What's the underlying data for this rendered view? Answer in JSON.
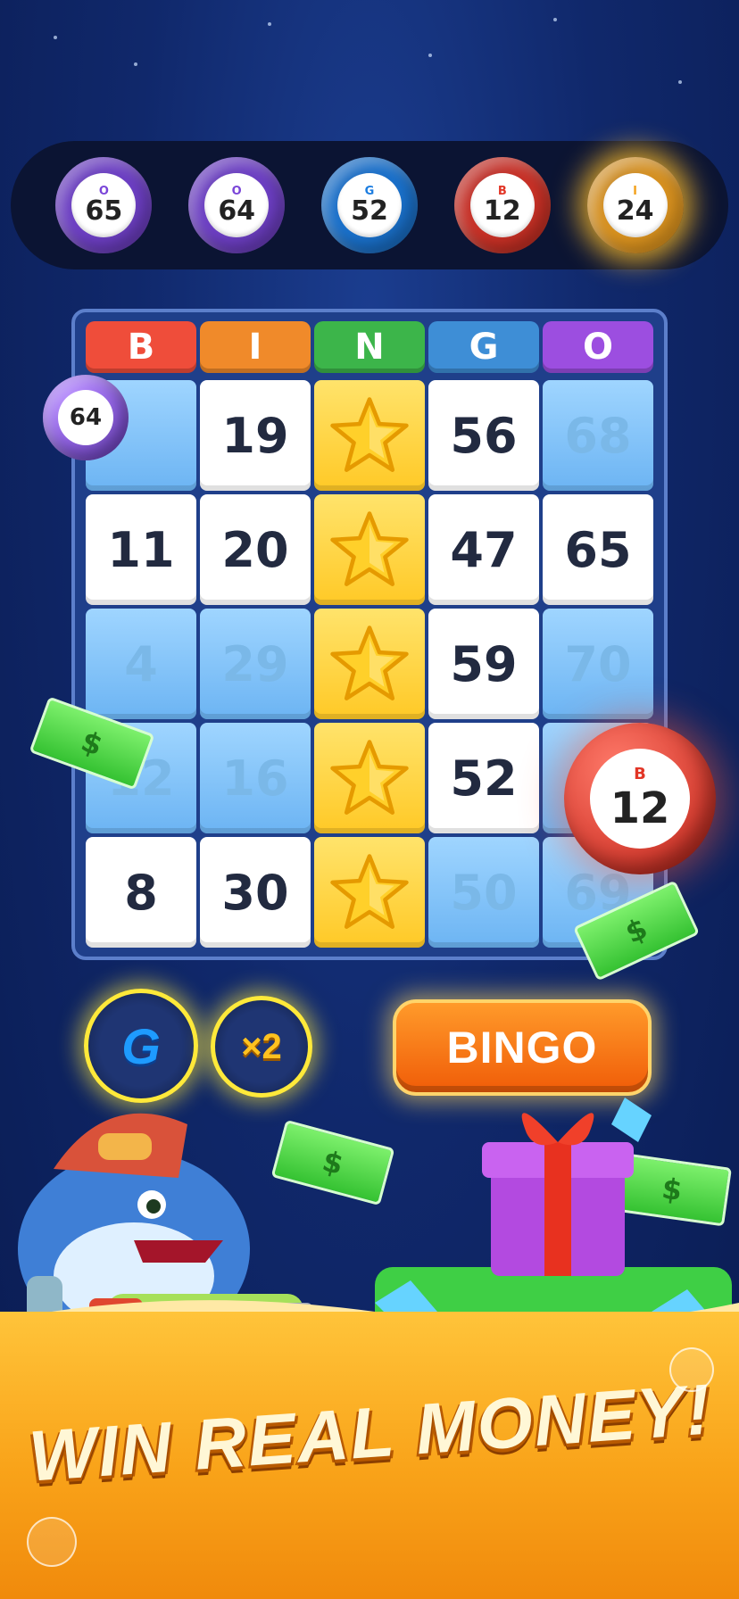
{
  "called_balls": [
    {
      "letter": "O",
      "number": "65",
      "color": "#7a45d8"
    },
    {
      "letter": "O",
      "number": "64",
      "color": "#7a45d8"
    },
    {
      "letter": "G",
      "number": "52",
      "color": "#1c7de0"
    },
    {
      "letter": "B",
      "number": "12",
      "color": "#e23526"
    },
    {
      "letter": "I",
      "number": "24",
      "color": "#f3a21e"
    }
  ],
  "board": {
    "headers": [
      {
        "label": "B",
        "color": "#ef4d3a"
      },
      {
        "label": "I",
        "color": "#f08a2a"
      },
      {
        "label": "N",
        "color": "#3cb54a"
      },
      {
        "label": "G",
        "color": "#3e8ed6"
      },
      {
        "label": "O",
        "color": "#9c4ee0"
      }
    ],
    "rows": [
      [
        {
          "v": "",
          "s": "marked"
        },
        {
          "v": "19",
          "s": "white"
        },
        {
          "v": "",
          "s": "star"
        },
        {
          "v": "56",
          "s": "white"
        },
        {
          "v": "68",
          "s": "marked"
        }
      ],
      [
        {
          "v": "11",
          "s": "white"
        },
        {
          "v": "20",
          "s": "white"
        },
        {
          "v": "",
          "s": "star"
        },
        {
          "v": "47",
          "s": "white"
        },
        {
          "v": "65",
          "s": "white"
        }
      ],
      [
        {
          "v": "4",
          "s": "marked"
        },
        {
          "v": "29",
          "s": "marked"
        },
        {
          "v": "",
          "s": "star"
        },
        {
          "v": "59",
          "s": "white"
        },
        {
          "v": "70",
          "s": "marked"
        }
      ],
      [
        {
          "v": "12",
          "s": "marked"
        },
        {
          "v": "16",
          "s": "marked"
        },
        {
          "v": "",
          "s": "star"
        },
        {
          "v": "52",
          "s": "white"
        },
        {
          "v": "",
          "s": "marked"
        }
      ],
      [
        {
          "v": "8",
          "s": "white"
        },
        {
          "v": "30",
          "s": "white"
        },
        {
          "v": "",
          "s": "star"
        },
        {
          "v": "50",
          "s": "marked"
        },
        {
          "v": "69",
          "s": "marked"
        }
      ]
    ]
  },
  "flying_balls": {
    "left": {
      "letter": "",
      "number": "64",
      "color": "#7a45d8"
    },
    "right": {
      "letter": "B",
      "number": "12",
      "color": "#e23526"
    }
  },
  "boosters": {
    "g_label": "G",
    "x2_label": "×2"
  },
  "bingo_button_label": "BINGO",
  "headline": "WIN REAL MONEY!",
  "cash_symbol": "$"
}
